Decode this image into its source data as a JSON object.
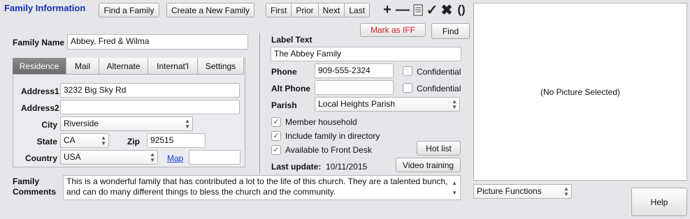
{
  "header": {
    "title": "Family Information",
    "find_family": "Find a Family",
    "create_family": "Create a New Family",
    "nav": {
      "first": "First",
      "prior": "Prior",
      "next": "Next",
      "last": "Last"
    }
  },
  "toolbar_icons": [
    "add-icon",
    "remove-icon",
    "notes-icon",
    "check-icon",
    "cancel-icon",
    "refresh-icon"
  ],
  "actions": {
    "mark_iff": "Mark as IFF",
    "find": "Find"
  },
  "family_name": {
    "label": "Family Name",
    "value": "Abbey, Fred & Wilma"
  },
  "tabs": [
    "Residence",
    "Mail",
    "Alternate",
    "Internat'l",
    "Settings"
  ],
  "address": {
    "address1_label": "Address1",
    "address1": "3232 Big Sky Rd",
    "address2_label": "Address2",
    "address2": "",
    "city_label": "City",
    "city": "Riverside",
    "state_label": "State",
    "state": "CA",
    "zip_label": "Zip",
    "zip": "92515",
    "country_label": "Country",
    "country": "USA",
    "map_link": "Map",
    "map_extra": ""
  },
  "right": {
    "label_text_label": "Label Text",
    "label_text": "The Abbey Family",
    "phone_label": "Phone",
    "phone": "909-555-2324",
    "alt_phone_label": "Alt Phone",
    "alt_phone": "",
    "confidential": "Confidential",
    "parish_label": "Parish",
    "parish": "Local Heights Parish",
    "member_household": "Member household",
    "include_directory": "Include family in directory",
    "front_desk": "Available to Front Desk",
    "hot_list": "Hot list",
    "last_update_label": "Last update:",
    "last_update": "10/11/2015",
    "video_training": "Video training"
  },
  "comments": {
    "label": "Family Comments",
    "text": "This is a wonderful family that has contributed a lot to the life of this church. They are a talented bunch, and can do many different things to bless the church and the community."
  },
  "picture": {
    "placeholder": "(No Picture Selected)",
    "functions": "Picture Functions"
  },
  "help": "Help"
}
